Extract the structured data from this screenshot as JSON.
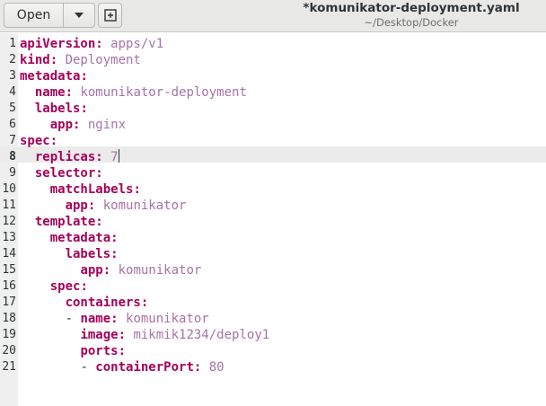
{
  "header": {
    "open_label": "Open",
    "title": "*komunikator-deployment.yaml",
    "subtitle": "~/Desktop/Docker"
  },
  "editor": {
    "current_line": 8,
    "lines": [
      {
        "n": "1",
        "indent": "",
        "dash": "",
        "key": "apiVersion",
        "sep": ": ",
        "value": "apps/v1"
      },
      {
        "n": "2",
        "indent": "",
        "dash": "",
        "key": "kind",
        "sep": ": ",
        "value": "Deployment"
      },
      {
        "n": "3",
        "indent": "",
        "dash": "",
        "key": "metadata",
        "sep": ":",
        "value": ""
      },
      {
        "n": "4",
        "indent": "  ",
        "dash": "",
        "key": "name",
        "sep": ": ",
        "value": "komunikator-deployment"
      },
      {
        "n": "5",
        "indent": "  ",
        "dash": "",
        "key": "labels",
        "sep": ":",
        "value": ""
      },
      {
        "n": "6",
        "indent": "    ",
        "dash": "",
        "key": "app",
        "sep": ": ",
        "value": "nginx"
      },
      {
        "n": "7",
        "indent": "",
        "dash": "",
        "key": "spec",
        "sep": ":",
        "value": ""
      },
      {
        "n": "8",
        "indent": "  ",
        "dash": "",
        "key": "replicas",
        "sep": ": ",
        "value": "7"
      },
      {
        "n": "9",
        "indent": "  ",
        "dash": "",
        "key": "selector",
        "sep": ":",
        "value": ""
      },
      {
        "n": "10",
        "indent": "    ",
        "dash": "",
        "key": "matchLabels",
        "sep": ":",
        "value": ""
      },
      {
        "n": "11",
        "indent": "      ",
        "dash": "",
        "key": "app",
        "sep": ": ",
        "value": "komunikator"
      },
      {
        "n": "12",
        "indent": "  ",
        "dash": "",
        "key": "template",
        "sep": ":",
        "value": ""
      },
      {
        "n": "13",
        "indent": "    ",
        "dash": "",
        "key": "metadata",
        "sep": ":",
        "value": ""
      },
      {
        "n": "14",
        "indent": "      ",
        "dash": "",
        "key": "labels",
        "sep": ":",
        "value": ""
      },
      {
        "n": "15",
        "indent": "        ",
        "dash": "",
        "key": "app",
        "sep": ": ",
        "value": "komunikator"
      },
      {
        "n": "16",
        "indent": "    ",
        "dash": "",
        "key": "spec",
        "sep": ":",
        "value": ""
      },
      {
        "n": "17",
        "indent": "      ",
        "dash": "",
        "key": "containers",
        "sep": ":",
        "value": ""
      },
      {
        "n": "18",
        "indent": "      ",
        "dash": "- ",
        "key": "name",
        "sep": ": ",
        "value": "komunikator"
      },
      {
        "n": "19",
        "indent": "        ",
        "dash": "",
        "key": "image",
        "sep": ": ",
        "value": "mikmik1234/deploy1"
      },
      {
        "n": "20",
        "indent": "        ",
        "dash": "",
        "key": "ports",
        "sep": ":",
        "value": ""
      },
      {
        "n": "21",
        "indent": "        ",
        "dash": "- ",
        "key": "containerPort",
        "sep": ": ",
        "value": "80"
      }
    ]
  }
}
